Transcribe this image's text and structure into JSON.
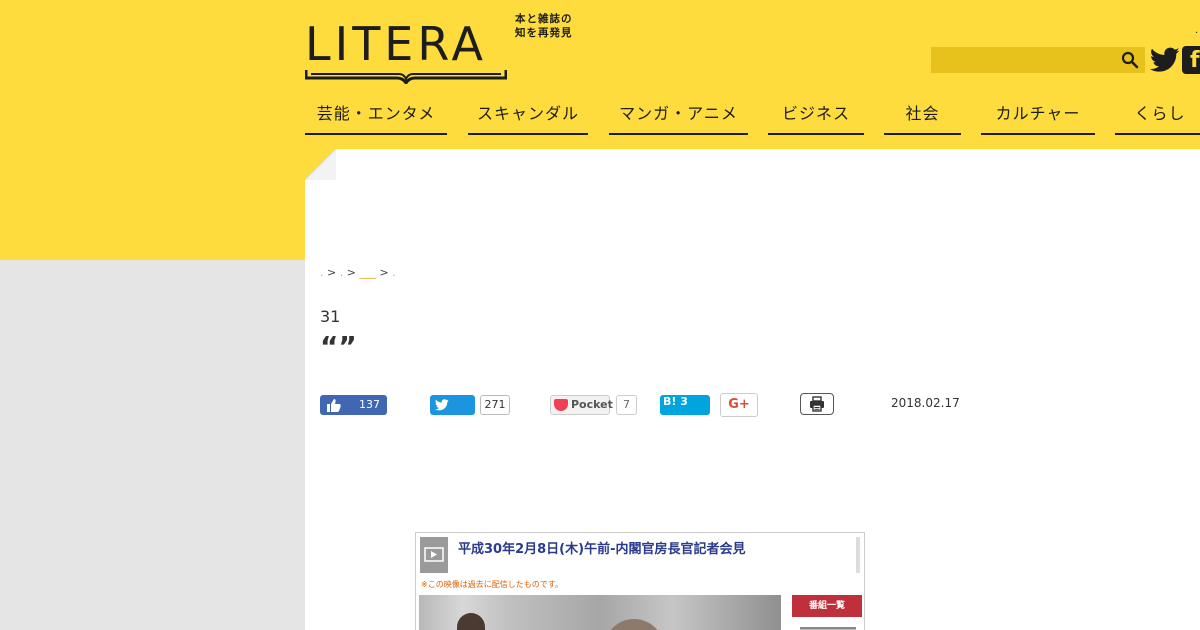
{
  "header": {
    "logo_text": "LITERA",
    "logo_tagline_line1": "本と雑誌の",
    "logo_tagline_line2": "知を再発見",
    "dot": ".",
    "search": {
      "value": "",
      "placeholder": ""
    },
    "facebook_glyph": "f"
  },
  "nav": {
    "items": [
      {
        "label": "芸能・エンタメ"
      },
      {
        "label": "スキャンダル"
      },
      {
        "label": "マンガ・アニメ"
      },
      {
        "label": "ビジネス"
      },
      {
        "label": "社会"
      },
      {
        "label": "カルチャー"
      },
      {
        "label": "くらし"
      }
    ]
  },
  "breadcrumb": {
    "item1": ".",
    "sep": ">",
    "item2": ".",
    "item3": "___",
    "item4": "."
  },
  "article": {
    "headline_small": "31",
    "headline_quote": "“”",
    "date": "2018.02.17"
  },
  "social": {
    "facebook_count": "137",
    "twitter_count": "271",
    "pocket_label": "Pocket",
    "pocket_count": "7",
    "hatena_label": "B! 3",
    "gplus_label": "G+"
  },
  "video": {
    "title": "平成30年2月8日(木)午前-内閣官房長官記者会見",
    "note": "※この映像は過去に配信したものです。",
    "program_button": "番組一覧"
  },
  "colors": {
    "brand_yellow": "#ffdc3e",
    "facebook_blue": "#4267b2",
    "twitter_blue": "#1b95e0",
    "pocket_red": "#ef4056",
    "hatena_blue": "#00a4de",
    "breadcrumb_link": "#e7a41c"
  }
}
